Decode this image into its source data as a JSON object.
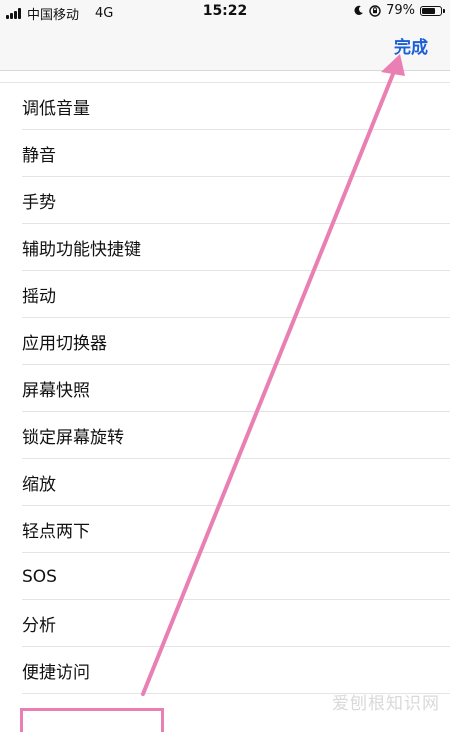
{
  "status_bar": {
    "carrier": "中国移动",
    "network": "4G",
    "time": "15:22",
    "battery_percent": "79%",
    "battery_level": 0.79,
    "icons": [
      "signal-icon",
      "moon-icon",
      "orientation-lock-icon",
      "battery-icon"
    ]
  },
  "nav": {
    "done_label": "完成"
  },
  "list": {
    "items": [
      {
        "label": "调低音量"
      },
      {
        "label": "静音"
      },
      {
        "label": "手势"
      },
      {
        "label": "辅助功能快捷键"
      },
      {
        "label": "摇动"
      },
      {
        "label": "应用切换器"
      },
      {
        "label": "屏幕快照"
      },
      {
        "label": "锁定屏幕旋转"
      },
      {
        "label": "缩放"
      },
      {
        "label": "轻点两下"
      },
      {
        "label": "SOS"
      },
      {
        "label": "分析"
      },
      {
        "label": "便捷访问"
      }
    ]
  },
  "annotation": {
    "color": "#e97fb3"
  },
  "watermark": {
    "text": "爱刨根知识网"
  },
  "colors": {
    "accent": "#1a5fd6",
    "separator": "#e4e4e4",
    "bar_bg": "#f7f7f7"
  }
}
